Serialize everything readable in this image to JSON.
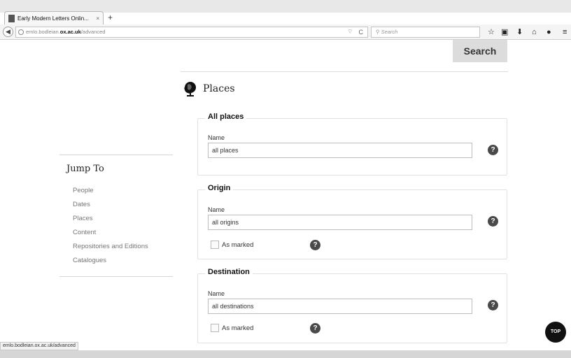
{
  "browser": {
    "tab_title": "Early Modern Letters Onlin...",
    "tab_close": "×",
    "new_tab": "+",
    "url_host_prefix": "emlo.bodleian.",
    "url_host_strong": "ox.ac.uk",
    "url_path": "/advanced",
    "url_dropdown": "▽",
    "url_reload": "C",
    "search_placeholder": "Search",
    "status_url": "emlo.bodleian.ox.ac.uk/advanced"
  },
  "page": {
    "search_button": "Search",
    "section_title": "Places",
    "all_places": {
      "legend": "All places",
      "name_label": "Name",
      "name_value": "all places",
      "help": "?"
    },
    "origin": {
      "legend": "Origin",
      "name_label": "Name",
      "name_value": "all origins",
      "as_marked_label": "As marked",
      "help": "?"
    },
    "destination": {
      "legend": "Destination",
      "name_label": "Name",
      "name_value": "all destinations",
      "as_marked_label": "As marked",
      "help": "?"
    },
    "top_button": "TOP"
  },
  "jump_to": {
    "title": "Jump To",
    "links": [
      "People",
      "Dates",
      "Places",
      "Content",
      "Repositories and Editions",
      "Catalogues"
    ]
  }
}
